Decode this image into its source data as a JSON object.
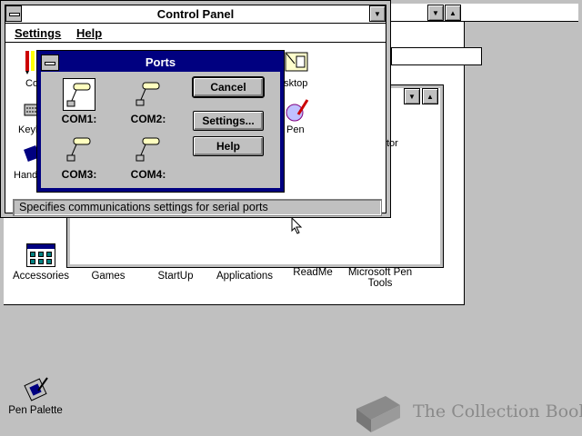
{
  "control_panel": {
    "title": "Control Panel",
    "menu": [
      "Settings",
      "Help"
    ],
    "status": "Specifies communications settings for serial ports",
    "partial_labels": [
      "Co",
      "Keyb",
      "Hand",
      "esktop",
      "Pen",
      "tor"
    ]
  },
  "ports_dialog": {
    "title": "Ports",
    "ports": [
      "COM1:",
      "COM2:",
      "COM3:",
      "COM4:"
    ],
    "buttons": {
      "cancel": "Cancel",
      "settings": "Settings...",
      "help": "Help"
    }
  },
  "program_manager": {
    "groups": [
      "Accessories",
      "Games",
      "StartUp",
      "Applications",
      "ReadMe",
      "Microsoft Pen Tools"
    ]
  },
  "desktop": {
    "icon_label": "Pen Palette",
    "watermark": "The Collection Book"
  },
  "colors": {
    "title_active": "#000080",
    "desktop": "#c0c0c0",
    "face": "#c0c0c0"
  }
}
